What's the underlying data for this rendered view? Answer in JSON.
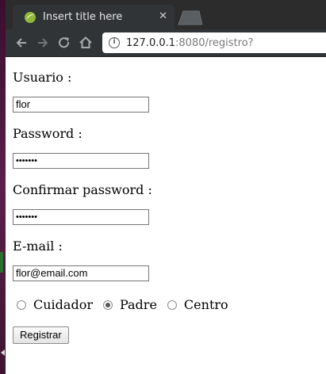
{
  "browser": {
    "tab_title": "Insert title here",
    "tab_close": "✕",
    "url_host": "127.0.0.1",
    "url_path": ":8080/registro?",
    "icons": [
      "eclipse-favicon-icon",
      "back-arrow-icon",
      "forward-arrow-icon",
      "reload-icon",
      "home-icon",
      "info-icon",
      "close-icon"
    ]
  },
  "form": {
    "usuario_label": "Usuario :",
    "usuario_value": "flor",
    "password_label": "Password :",
    "password_value": "•••••••",
    "confirm_label": "Confirmar password :",
    "confirm_value": "•••••••",
    "email_label": "E-mail :",
    "email_value": "flor@email.com",
    "roles": [
      {
        "label": "Cuidador",
        "checked": false
      },
      {
        "label": "Padre",
        "checked": true
      },
      {
        "label": "Centro",
        "checked": false
      }
    ],
    "submit_label": "Registrar"
  }
}
